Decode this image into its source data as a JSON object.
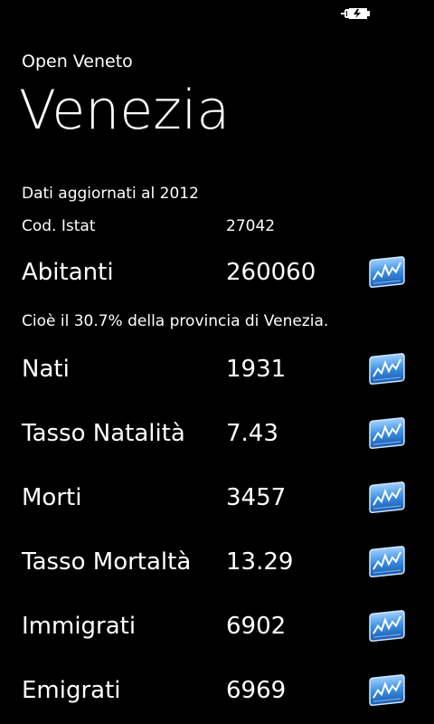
{
  "status": {
    "battery_icon": "battery-charging-icon"
  },
  "header": {
    "app_title": "Open Veneto",
    "city": "Venezia"
  },
  "info": {
    "updated": "Dati aggiornati al 2012",
    "istat_label": "Cod. Istat",
    "istat_value": "27042",
    "share_text": "Cioè il 30.7% della provincia di Venezia."
  },
  "stats": [
    {
      "label": "Abitanti",
      "value": "260060",
      "icon": "chart-icon"
    },
    {
      "label": "Nati",
      "value": "1931",
      "icon": "chart-icon"
    },
    {
      "label": "Tasso Natalità",
      "value": "7.43",
      "icon": "chart-icon"
    },
    {
      "label": "Morti",
      "value": "3457",
      "icon": "chart-icon"
    },
    {
      "label": "Tasso Mortaltà",
      "value": "13.29",
      "icon": "chart-icon"
    },
    {
      "label": "Immigrati",
      "value": "6902",
      "icon": "chart-icon"
    },
    {
      "label": "Emigrati",
      "value": "6969",
      "icon": "chart-icon"
    }
  ],
  "colors": {
    "background": "#000000",
    "text": "#ffffff",
    "icon_blue": "#3b8fe0"
  }
}
